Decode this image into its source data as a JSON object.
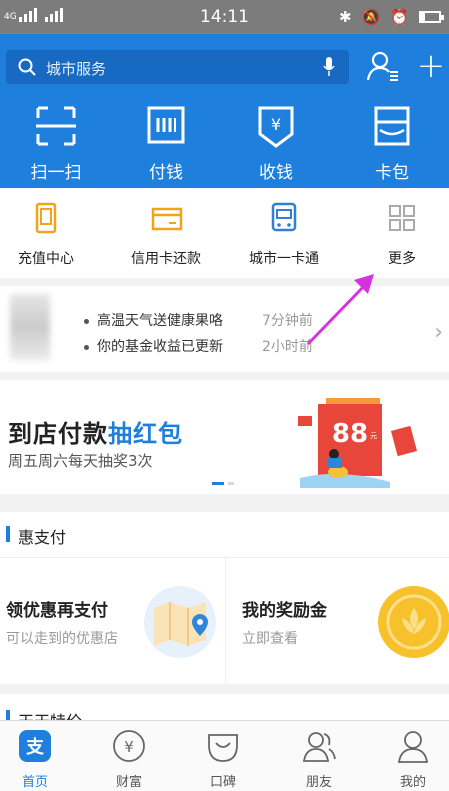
{
  "status_bar": {
    "network": "4G",
    "time": "14:11"
  },
  "search": {
    "placeholder": "城市服务"
  },
  "quick_actions": [
    {
      "label": "扫一扫",
      "icon": "scan-icon"
    },
    {
      "label": "付钱",
      "icon": "barcode-pay-icon"
    },
    {
      "label": "收钱",
      "icon": "yuan-receive-icon"
    },
    {
      "label": "卡包",
      "icon": "card-wallet-icon"
    }
  ],
  "services": [
    {
      "label": "充值中心",
      "icon": "phone-topup-icon"
    },
    {
      "label": "信用卡还款",
      "icon": "credit-card-icon"
    },
    {
      "label": "城市一卡通",
      "icon": "transit-card-icon"
    },
    {
      "label": "更多",
      "icon": "grid-more-icon"
    }
  ],
  "notifications": [
    {
      "text": "高温天气送健康果咯",
      "time": "7分钟前"
    },
    {
      "text": "你的基金收益已更新",
      "time": "2小时前"
    }
  ],
  "banner": {
    "title_prefix": "到店付款",
    "title_highlight": "抽红包",
    "subtitle": "周五周六每天抽奖3次",
    "badge": "88",
    "badge_unit": "元"
  },
  "section_discount": {
    "title": "惠支付",
    "cards": [
      {
        "title": "领优惠再支付",
        "subtitle": "可以走到的优惠店"
      },
      {
        "title": "我的奖励金",
        "subtitle": "立即查看"
      }
    ]
  },
  "section_daily": {
    "title": "天天特价"
  },
  "tabs": [
    {
      "label": "首页",
      "icon": "alipay-home-icon",
      "active": true
    },
    {
      "label": "财富",
      "icon": "wealth-icon",
      "active": false
    },
    {
      "label": "口碑",
      "icon": "koubei-icon",
      "active": false
    },
    {
      "label": "朋友",
      "icon": "friends-icon",
      "active": false
    },
    {
      "label": "我的",
      "icon": "profile-icon",
      "active": false
    }
  ],
  "colors": {
    "brand_blue": "#1e7fdd",
    "annotation_arrow": "#d633e0",
    "banner_red": "#e8463a"
  }
}
